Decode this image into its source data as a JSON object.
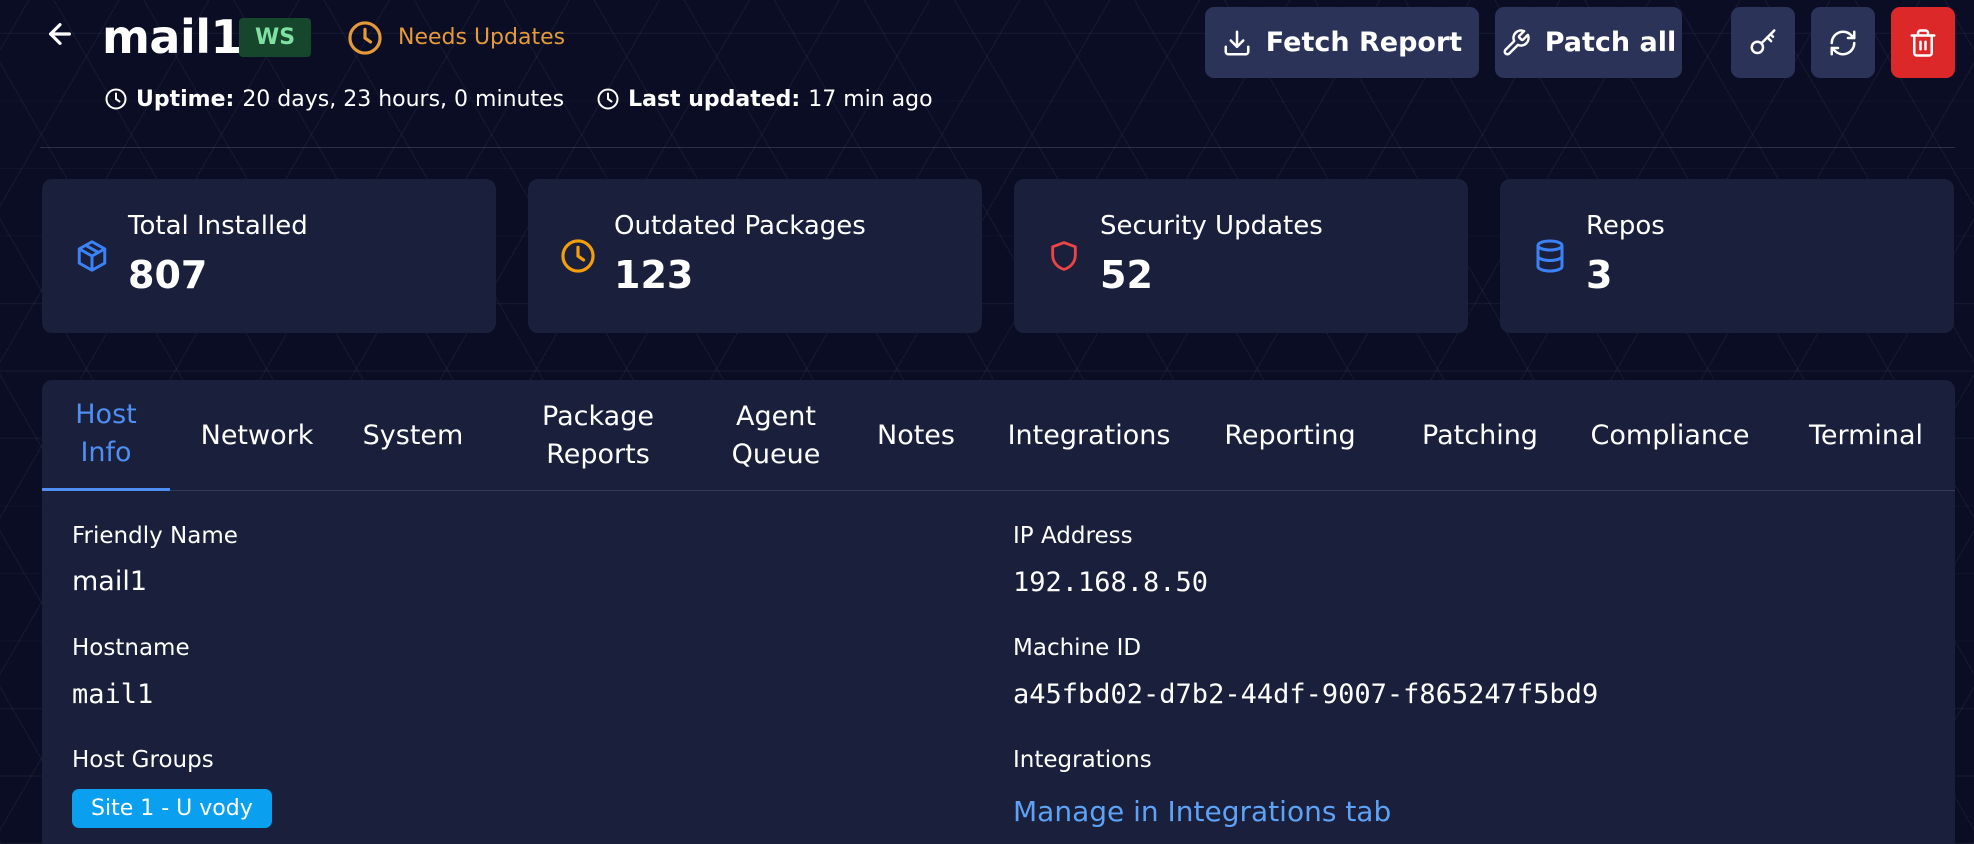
{
  "header": {
    "host_name": "mail1",
    "badge": "WS",
    "status": "Needs Updates",
    "uptime_label": "Uptime:",
    "uptime_value": "20 days, 23 hours, 0 minutes",
    "updated_label": "Last updated:",
    "updated_value": "17 min ago"
  },
  "actions": {
    "fetch_report": "Fetch Report",
    "patch_all": "Patch all"
  },
  "stats": [
    {
      "label": "Total Installed",
      "value": "807",
      "icon": "package-icon",
      "color": "#3b82f6"
    },
    {
      "label": "Outdated Packages",
      "value": "123",
      "icon": "clock-icon",
      "color": "#f59e0b"
    },
    {
      "label": "Security Updates",
      "value": "52",
      "icon": "shield-icon",
      "color": "#ef4444"
    },
    {
      "label": "Repos",
      "value": "3",
      "icon": "database-icon",
      "color": "#3b82f6"
    }
  ],
  "tabs": [
    {
      "l1": "Host",
      "l2": "Info",
      "active": true
    },
    {
      "l1": "Network"
    },
    {
      "l1": "System"
    },
    {
      "l1": "Package",
      "l2": "Reports"
    },
    {
      "l1": "Agent",
      "l2": "Queue"
    },
    {
      "l1": "Notes"
    },
    {
      "l1": "Integrations"
    },
    {
      "l1": "Reporting"
    },
    {
      "l1": "Patching"
    },
    {
      "l1": "Compliance"
    },
    {
      "l1": "Terminal"
    }
  ],
  "info": {
    "friendly_name_label": "Friendly Name",
    "friendly_name": "mail1",
    "hostname_label": "Hostname",
    "hostname": "mail1",
    "host_groups_label": "Host Groups",
    "host_group": "Site 1 - U vody",
    "ip_label": "IP Address",
    "ip": "192.168.8.50",
    "machine_id_label": "Machine ID",
    "machine_id": "a45fbd02-d7b2-44df-9007-f865247f5bd9",
    "integrations_label": "Integrations",
    "integrations_link": "Manage in Integrations tab"
  },
  "colors": {
    "background": "#0a0d24",
    "card": "#1a1f3b",
    "accent": "#4f8ef2",
    "danger": "#dc2828",
    "warning": "#e59a3a",
    "badge_bg": "#16472c",
    "badge_fg": "#7fe0a2",
    "chip": "#0aa0ef"
  }
}
